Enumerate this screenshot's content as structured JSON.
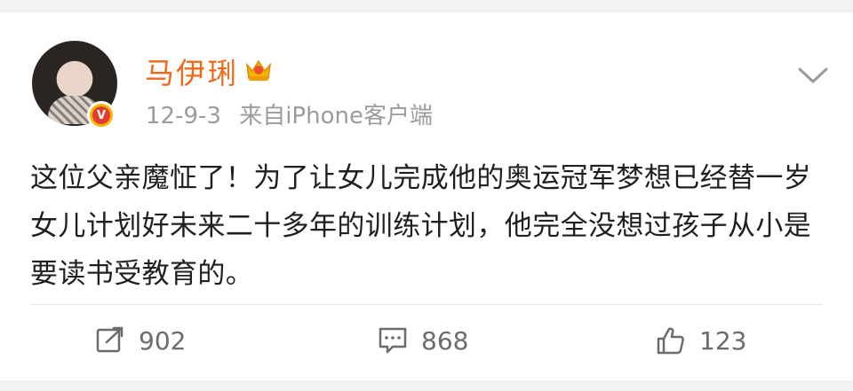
{
  "post": {
    "author": "马伊琍",
    "date": "12-9-3",
    "source": "来自iPhone客户端",
    "verified_badge": "V",
    "content": "这位父亲魔怔了！为了让女儿完成他的奥运冠军梦想已经替一岁女儿计划好未来二十多年的训练计划，他完全没想过孩子从小是要读书受教育的。"
  },
  "actions": {
    "repost_count": "902",
    "comment_count": "868",
    "like_count": "123"
  },
  "icons": {
    "repost": "share-icon",
    "comment": "comment-icon",
    "like": "thumbs-up-icon",
    "menu": "chevron-down-icon",
    "crown": "crown-icon"
  },
  "colors": {
    "author": "#ef6a18",
    "meta": "#9b9b9b",
    "text": "#1f1f1f",
    "badge": "#f7b500"
  }
}
